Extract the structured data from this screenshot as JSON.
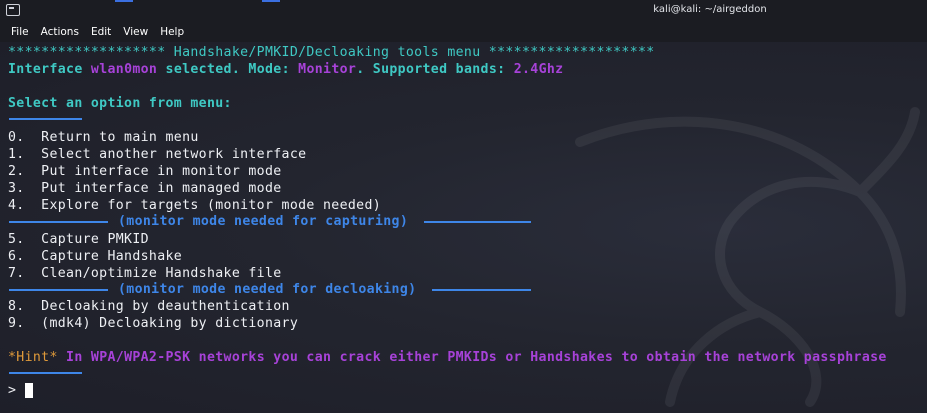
{
  "window": {
    "title": "kali@kali: ~/airgeddon"
  },
  "menu": {
    "file": "File",
    "actions": "Actions",
    "edit": "Edit",
    "view": "View",
    "help": "Help"
  },
  "terminal": {
    "header": "******************* Handshake/PMKID/Decloaking tools menu ********************",
    "interface_prefix": "Interface ",
    "interface_name": "wlan0mon",
    "interface_selected": " selected. Mode: ",
    "mode": "Monitor",
    "bands_label": ". Supported bands: ",
    "bands": "2.4Ghz",
    "select_prompt": "Select an option from menu:",
    "options_a": [
      "0.  Return to main menu",
      "1.  Select another network interface",
      "2.  Put interface in monitor mode",
      "3.  Put interface in managed mode",
      "4.  Explore for targets (monitor mode needed)"
    ],
    "section_capture": "(monitor mode needed for capturing)",
    "options_b": [
      "5.  Capture PMKID",
      "6.  Capture Handshake",
      "7.  Clean/optimize Handshake file"
    ],
    "section_decloak": "(monitor mode needed for decloaking)",
    "options_c": [
      "8.  Decloaking by deauthentication",
      "9.  (mdk4) Decloaking by dictionary"
    ],
    "hint_label": "*Hint*",
    "hint_text": " In WPA/WPA2-PSK networks you can crack either PMKIDs or Handshakes to obtain the network passphrase",
    "prompt_symbol": ">"
  },
  "colors": {
    "background": "#1e1f29",
    "cyan": "#3fc9c4",
    "purple": "#a742d8",
    "blue": "#3e86e8",
    "orange": "#e09a3a"
  },
  "icons": {
    "app_icon": "terminal-icon",
    "watermark": "kali-dragon-icon"
  }
}
